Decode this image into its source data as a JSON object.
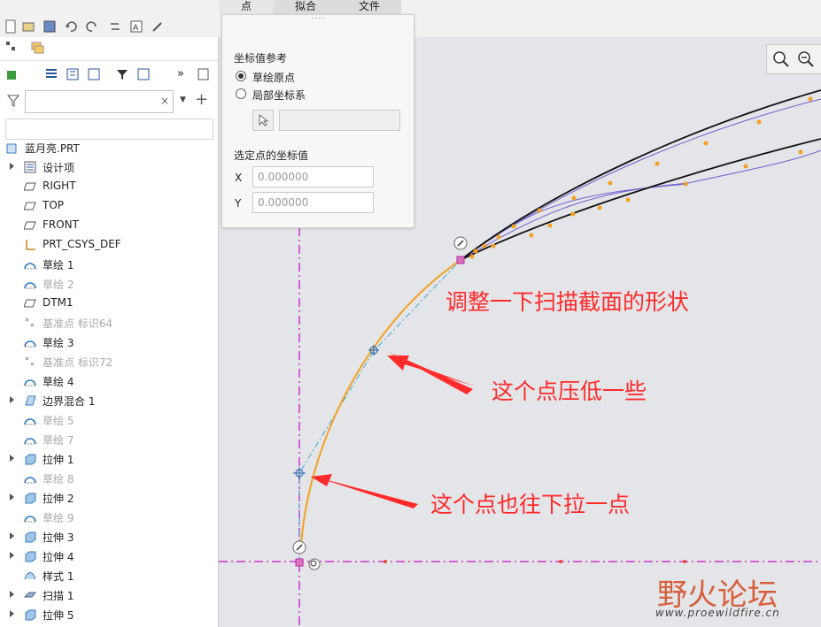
{
  "ribbon": {
    "tabs": [
      {
        "label": "点",
        "active": true
      },
      {
        "label": "拟合",
        "active": false
      },
      {
        "label": "文件",
        "active": false
      }
    ]
  },
  "model_tree": {
    "search_placeholder": "",
    "items": [
      {
        "label": "蓝月亮.PRT",
        "icon": "part-icon",
        "dim": false,
        "expandable": false
      },
      {
        "label": "设计项",
        "icon": "design-items-icon",
        "dim": false,
        "expandable": true
      },
      {
        "label": "RIGHT",
        "icon": "datum-plane-icon",
        "dim": false,
        "expandable": false
      },
      {
        "label": "TOP",
        "icon": "datum-plane-icon",
        "dim": false,
        "expandable": false
      },
      {
        "label": "FRONT",
        "icon": "datum-plane-icon",
        "dim": false,
        "expandable": false
      },
      {
        "label": "PRT_CSYS_DEF",
        "icon": "csys-icon",
        "dim": false,
        "expandable": false
      },
      {
        "label": "草绘 1",
        "icon": "sketch-icon",
        "dim": false,
        "expandable": false
      },
      {
        "label": "草绘 2",
        "icon": "sketch-icon",
        "dim": true,
        "expandable": false
      },
      {
        "label": "DTM1",
        "icon": "datum-plane-icon",
        "dim": false,
        "expandable": false
      },
      {
        "label": "基准点 标识64",
        "icon": "datum-point-icon",
        "dim": true,
        "expandable": false
      },
      {
        "label": "草绘 3",
        "icon": "sketch-icon",
        "dim": false,
        "expandable": false
      },
      {
        "label": "基准点 标识72",
        "icon": "datum-point-icon",
        "dim": true,
        "expandable": false
      },
      {
        "label": "草绘 4",
        "icon": "sketch-icon",
        "dim": false,
        "expandable": false
      },
      {
        "label": "边界混合 1",
        "icon": "boundary-blend-icon",
        "dim": false,
        "expandable": true
      },
      {
        "label": "草绘 5",
        "icon": "sketch-icon",
        "dim": true,
        "expandable": false
      },
      {
        "label": "草绘 7",
        "icon": "sketch-icon",
        "dim": true,
        "expandable": false
      },
      {
        "label": "拉伸 1",
        "icon": "extrude-icon",
        "dim": false,
        "expandable": true
      },
      {
        "label": "草绘 8",
        "icon": "sketch-icon",
        "dim": true,
        "expandable": false
      },
      {
        "label": "拉伸 2",
        "icon": "extrude-icon",
        "dim": false,
        "expandable": true
      },
      {
        "label": "草绘 9",
        "icon": "sketch-icon",
        "dim": true,
        "expandable": false
      },
      {
        "label": "拉伸 3",
        "icon": "extrude-icon",
        "dim": false,
        "expandable": true
      },
      {
        "label": "拉伸 4",
        "icon": "extrude-icon",
        "dim": false,
        "expandable": true
      },
      {
        "label": "样式 1",
        "icon": "style-icon",
        "dim": false,
        "expandable": false
      },
      {
        "label": "扫描 1",
        "icon": "sweep-icon",
        "dim": false,
        "expandable": true
      },
      {
        "label": "拉伸 5",
        "icon": "extrude-icon",
        "dim": false,
        "expandable": true
      }
    ]
  },
  "point_dialog": {
    "ref_title": "坐标值参考",
    "radio_sketch_origin": "草绘原点",
    "radio_local_csys": "局部坐标系",
    "selected_title": "选定点的坐标值",
    "x_label": "X",
    "x_value": "0.000000",
    "y_label": "Y",
    "y_value": "0.000000"
  },
  "annotations": {
    "adjust_section": "调整一下扫描截面的形状",
    "lower_point": "这个点压低一些",
    "pull_point": "这个点也往下拉一点"
  },
  "watermark": {
    "name": "野火论坛",
    "url": "www.proewildfire.cn"
  },
  "colors": {
    "accent_orange": "#f5a020",
    "annotation_red": "#ff2a2a",
    "axis_magenta": "#cc33cc",
    "control_polygon_blue": "#3fa9d4",
    "guide_purple": "#6f5fd0"
  }
}
